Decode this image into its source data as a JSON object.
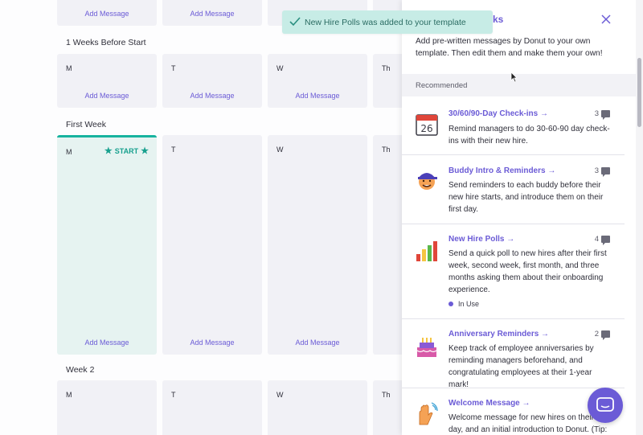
{
  "toast": {
    "message": "New Hire Polls was added to your template"
  },
  "panel": {
    "title_fragment": "ks",
    "intro": "Add pre-written messages by Donut to your own template. Then edit them and make them your own!",
    "recommended_label": "Recommended",
    "items": [
      {
        "title": "30/60/90-Day Check-ins →",
        "count": "3",
        "desc": "Remind managers to do 30-60-90 day check-ins with their new hire.",
        "calendar_day": "26"
      },
      {
        "title": "Buddy Intro & Reminders →",
        "count": "3",
        "desc": "Send reminders to each buddy before their new hire starts, and introduce them on their first day."
      },
      {
        "title": "New Hire Polls →",
        "count": "4",
        "desc": "Send a quick poll to new hires after their first week, second week, first month, and three months asking them about their onboarding experience.",
        "status": "In Use"
      },
      {
        "title": "Anniversary Reminders →",
        "count": "2",
        "desc": "Keep track of employee anniversaries by reminding managers beforehand, and congratulating employees at their 1-year mark!"
      },
      {
        "title": "Welcome Message →",
        "count": "",
        "desc": "Welcome message for new hires on their first day, and an initial introduction to Donut. (Tip:"
      }
    ]
  },
  "planner": {
    "add_message": "Add Message",
    "weeks": [
      {
        "title": "",
        "days": [
          "",
          "",
          "",
          ""
        ]
      },
      {
        "title": "1 Weeks Before Start",
        "days": [
          "M",
          "T",
          "W",
          "Th"
        ]
      },
      {
        "title": "First Week",
        "days": [
          "M",
          "T",
          "W",
          "Th"
        ],
        "start_label": "START"
      },
      {
        "title": "Week 2",
        "days": [
          "M",
          "T",
          "W",
          "Th"
        ]
      }
    ]
  },
  "colors": {
    "accent": "#6b5bd6",
    "teal": "#17b39f",
    "toast_bg": "#c7ece6"
  }
}
